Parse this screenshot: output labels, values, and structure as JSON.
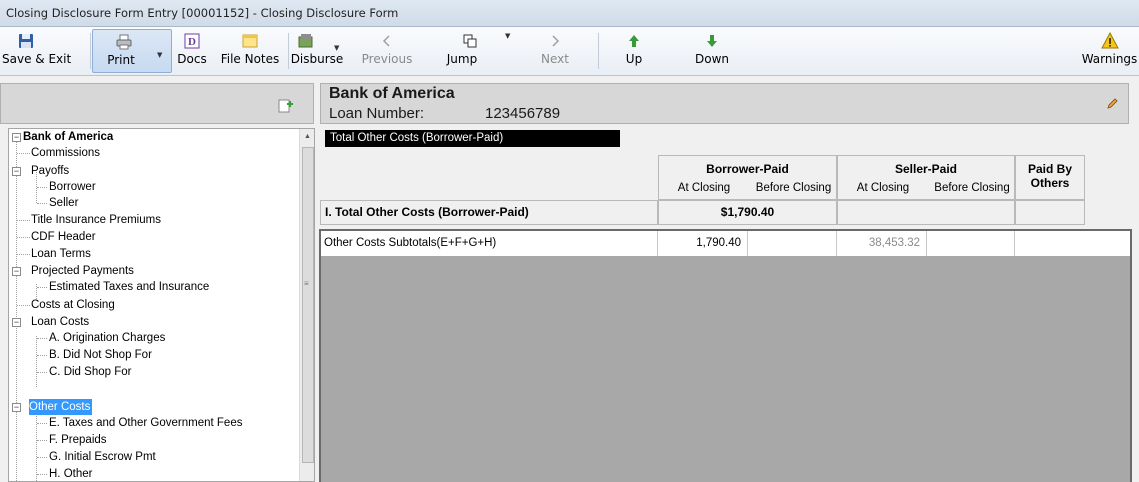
{
  "window": {
    "title": "Closing Disclosure Form Entry [00001152] - Closing Disclosure Form"
  },
  "toolbar": {
    "save_exit": "Save & Exit",
    "print": "Print",
    "docs": "Docs",
    "file_notes": "File Notes",
    "disburse": "Disburse",
    "previous": "Previous",
    "jump": "Jump",
    "next": "Next",
    "up": "Up",
    "down": "Down",
    "warnings": "Warnings"
  },
  "header": {
    "bank_name": "Bank of America",
    "loan_label": "Loan Number:",
    "loan_number": "123456789"
  },
  "tree": {
    "root": "Bank of America",
    "items": [
      "Commissions",
      "Payoffs",
      "Borrower",
      "Seller",
      "Title Insurance Premiums",
      "CDF Header",
      "Loan Terms",
      "Projected Payments",
      "Estimated Taxes and Insurance",
      "Costs at Closing",
      "Loan Costs",
      "A. Origination Charges",
      "B. Did Not Shop For",
      "C. Did Shop For",
      "Other Costs",
      "E. Taxes and Other Government Fees",
      "F. Prepaids",
      "G. Initial Escrow Pmt",
      "H. Other"
    ],
    "selected": "Other Costs"
  },
  "section": {
    "tab_label": "Total Other Costs (Borrower-Paid)",
    "col_borrower_paid": "Borrower-Paid",
    "col_seller_paid": "Seller-Paid",
    "col_paid_by_others": "Paid By Others",
    "sub_at_closing": "At Closing",
    "sub_before_closing": "Before Closing",
    "total_label": "I. Total Other Costs (Borrower-Paid)",
    "total_value": "$1,790.40",
    "row_label": "Other Costs Subtotals(E+F+G+H)",
    "row_borrower_at_closing": "1,790.40",
    "row_seller_at_closing": "38,453.32"
  }
}
